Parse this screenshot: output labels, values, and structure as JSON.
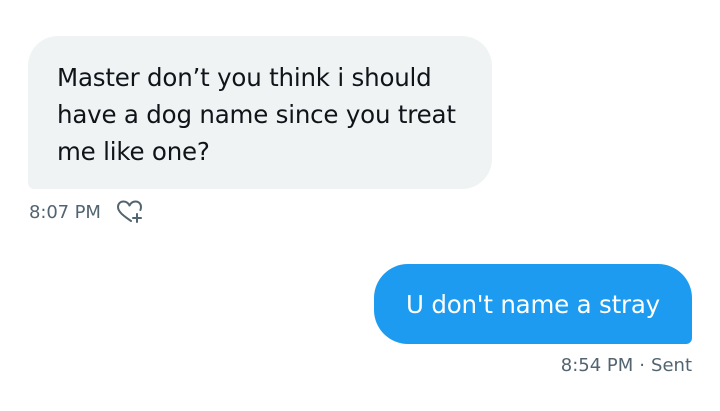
{
  "received_message": {
    "text": "Master don’t you think i should have a dog name since you treat me like one?",
    "time": "8:07 PM",
    "reaction_icon": "heart-plus-icon"
  },
  "sent_message": {
    "text": "U don't name a stray",
    "time": "8:54 PM",
    "separator": "·",
    "status": "Sent"
  },
  "colors": {
    "received_bubble": "#eff3f4",
    "sent_bubble": "#1d9bf0",
    "meta_text": "#536471",
    "body_text": "#0f1419"
  }
}
